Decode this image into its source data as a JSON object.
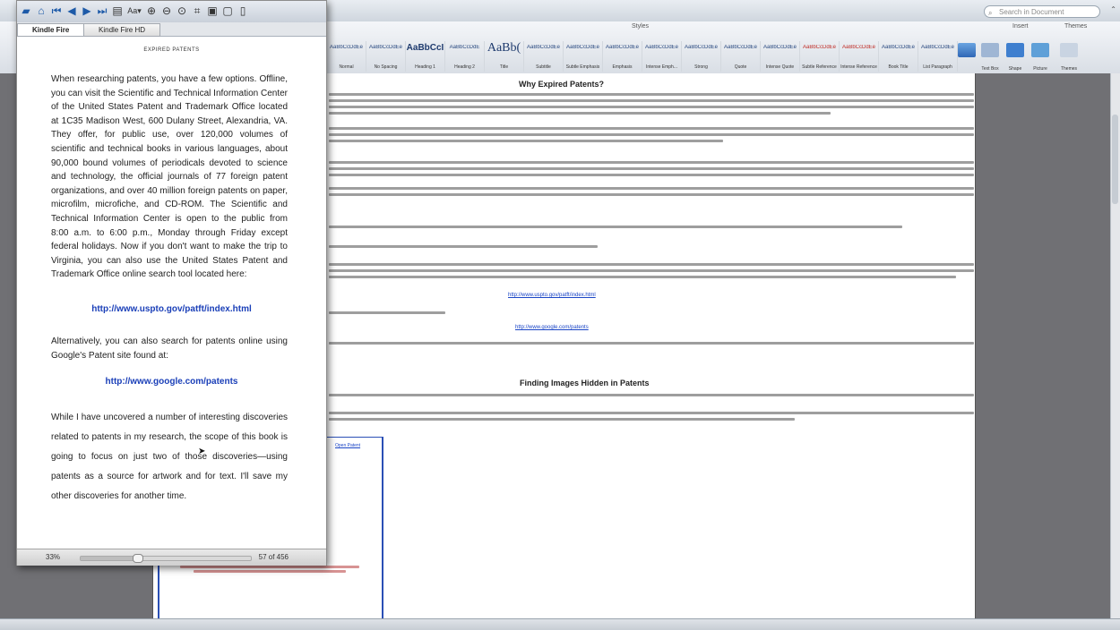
{
  "word": {
    "search_placeholder": "Search in Document",
    "ribbon": {
      "styles_group": "Styles",
      "insert_group": "Insert",
      "themes_group": "Themes",
      "styles": [
        {
          "sample": "AaBbCcDdEe",
          "name": "Normal"
        },
        {
          "sample": "AaBbCcDdEe",
          "name": "No Spacing"
        },
        {
          "sample": "AaBbCcI",
          "name": "Heading 1",
          "kind": "big"
        },
        {
          "sample": "AaBbCcDdE",
          "name": "Heading 2"
        },
        {
          "sample": "AaBb(",
          "name": "Title",
          "kind": "huge"
        },
        {
          "sample": "AaBbCcDdEe",
          "name": "Subtitle"
        },
        {
          "sample": "AaBbCcDdEe",
          "name": "Subtle Emphasis"
        },
        {
          "sample": "AaBbCcDdEe",
          "name": "Emphasis"
        },
        {
          "sample": "AaBbCcDdEe",
          "name": "Intense Emph..."
        },
        {
          "sample": "AaBbCcDdEe",
          "name": "Strong"
        },
        {
          "sample": "AaBbCcDdEe",
          "name": "Quote"
        },
        {
          "sample": "AaBbCcDdEe",
          "name": "Intense Quote"
        },
        {
          "sample": "AaBbCcDdEe",
          "name": "Subtle Reference",
          "kind": "red"
        },
        {
          "sample": "AaBbCcDdEe",
          "name": "Intense Reference",
          "kind": "red"
        },
        {
          "sample": "AaBbCcDdEe",
          "name": "Book Title"
        },
        {
          "sample": "AaBbCcDdEe",
          "name": "List Paragraph"
        }
      ],
      "tools": [
        {
          "name": "Text Box"
        },
        {
          "name": "Shape"
        },
        {
          "name": "Picture"
        },
        {
          "name": "Themes"
        }
      ]
    },
    "doc": {
      "heading1": "Why Expired Patents?",
      "link1": "http://www.uspto.gov/patft/index.html",
      "link2": "http://www.google.com/patents",
      "heading2": "Finding Images Hidden in Patents",
      "image_caption": "Open Patent"
    }
  },
  "kindle": {
    "tabs": [
      "Kindle Fire",
      "Kindle Fire HD"
    ],
    "active_tab": 0,
    "header": "EXPIRED PATENTS",
    "para1": "When researching patents, you have a few options. Offline, you can visit the Scientific and Technical Information Center of the United States Patent and Trademark Office located at 1C35 Madison West, 600 Dulany Street, Alexandria, VA. They offer, for public use, over 120,000 volumes of scientific and technical books in various languages, about 90,000 bound volumes of periodicals devoted to science and technology, the official journals of 77 foreign patent organizations, and over 40 million foreign patents on paper, microfilm, microfiche, and CD-ROM. The Scientific and Technical Information Center is open to the public from 8:00 a.m. to 6:00 p.m., Monday through Friday except federal holidays. Now if you don't want to make the trip to Virginia, you can also use the United States Patent and Trademark Office online search tool located here:",
    "link1": "http://www.uspto.gov/patft/index.html",
    "para2": "Alternatively, you can also search for patents online using Google's Patent site found at:",
    "link2": "http://www.google.com/patents",
    "para3": "While I have uncovered a number of interesting discoveries related to patents in my research, the scope of this book is going to focus on just two of those discoveries—using patents as a source for artwork and for text. I'll save my other discoveries for another time.",
    "status": {
      "percent": "33%",
      "location": "57 of 456",
      "progress": 0.33
    }
  }
}
